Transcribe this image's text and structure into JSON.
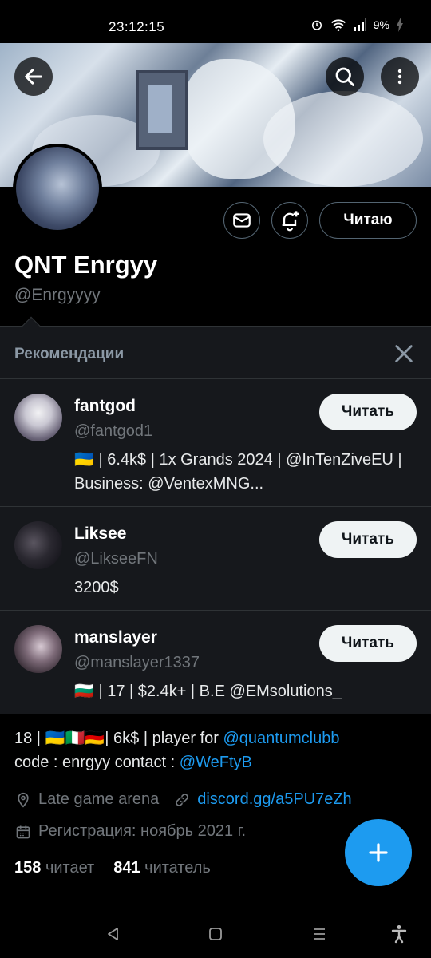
{
  "status_bar": {
    "time": "23:12:15",
    "battery": "9%"
  },
  "profile": {
    "name": "QNT Enrgyy",
    "handle": "@Enrgyyyy",
    "following_button": "Читаю",
    "bio_line1_prefix": "18 | 🇺🇦🇮🇹🇩🇪| 6k$ | player for ",
    "bio_link1": "@quantumclubb",
    "bio_line2_prefix": "code : enrgyy contact : ",
    "bio_link2": "@WeFtyB",
    "location": "Late game arena",
    "website": "discord.gg/a5PU7eZh",
    "joined": "Регистрация: ноябрь 2021 г.",
    "following_count": "158",
    "following_label": "читает",
    "followers_count": "841",
    "followers_label": "читатель"
  },
  "recommendations": {
    "title": "Рекомендации",
    "items": [
      {
        "name": "fantgod",
        "handle": "@fantgod1",
        "bio": "🇺🇦 | 6.4k$ | 1x Grands 2024 | @InTenZiveEU | Business: @VentexMNG...",
        "follow_label": "Читать"
      },
      {
        "name": "Liksee",
        "handle": "@LikseeFN",
        "bio": "3200$",
        "follow_label": "Читать"
      },
      {
        "name": "manslayer",
        "handle": "@manslayer1337",
        "bio": "🇧🇬 | 17 | $2.4k+ | B.E @EMsolutions_",
        "follow_label": "Читать"
      }
    ]
  },
  "colors": {
    "accent": "#1d9bf0",
    "background": "#000000",
    "panel": "#16181c",
    "muted": "#71767b"
  }
}
